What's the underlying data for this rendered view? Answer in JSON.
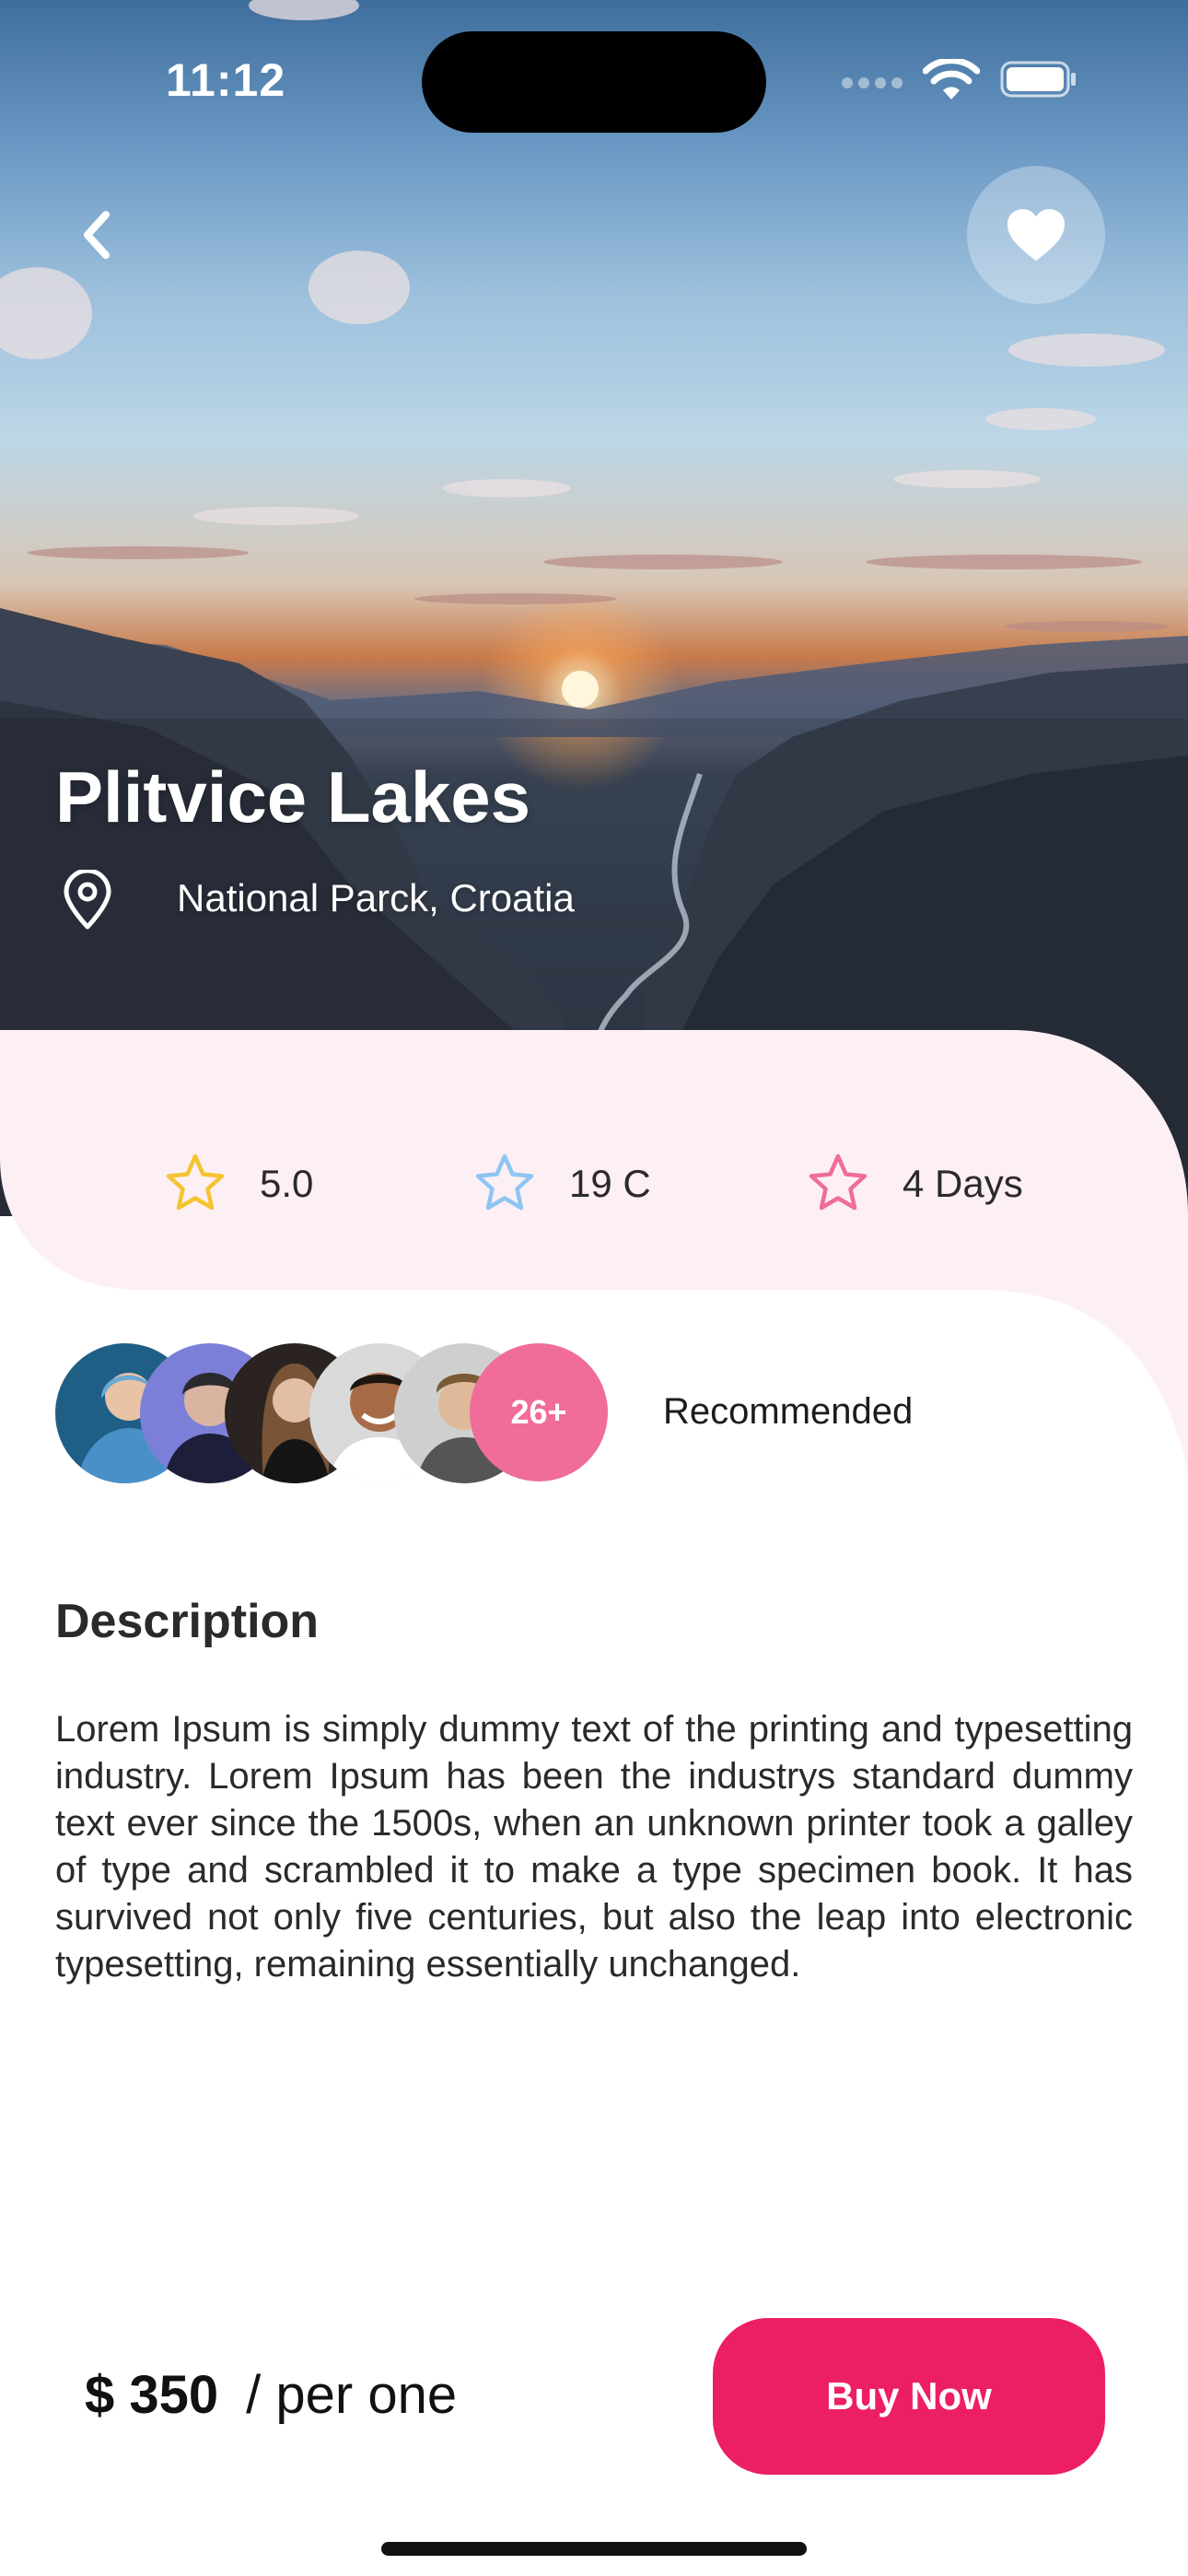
{
  "status_bar": {
    "time": "11:12"
  },
  "hero": {
    "back_icon": "chevron-left-icon",
    "favorite_icon": "heart-icon",
    "title": "Plitvice Lakes",
    "location_icon": "map-pin-icon",
    "location": "National Parck, Croatia"
  },
  "stats": [
    {
      "icon": "star-icon",
      "color": "#f4c430",
      "label": "5.0"
    },
    {
      "icon": "star-icon",
      "color": "#8ec5f2",
      "label": "19 C"
    },
    {
      "icon": "star-icon",
      "color": "#ef6c9b",
      "label": "4 Days"
    }
  ],
  "recommend": {
    "more_count": "26+",
    "label": "Recommended"
  },
  "description": {
    "title": "Description",
    "body": "Lorem Ipsum is simply dummy text of the printing and typesetting industry. Lorem Ipsum has been the industrys standard dummy text ever since the 1500s, when an unknown printer took a galley of type and scrambled it to make a type specimen book. It has survived not only five centuries, but also the leap into electronic typesetting, remaining essentially unchanged."
  },
  "purchase": {
    "price": "$ 350",
    "unit": "/ per one",
    "button_label": "Buy Now"
  },
  "colors": {
    "accent": "#ec1f63",
    "sheet_tint": "#fdf0f5",
    "avatar_more": "#ef6c9b"
  }
}
